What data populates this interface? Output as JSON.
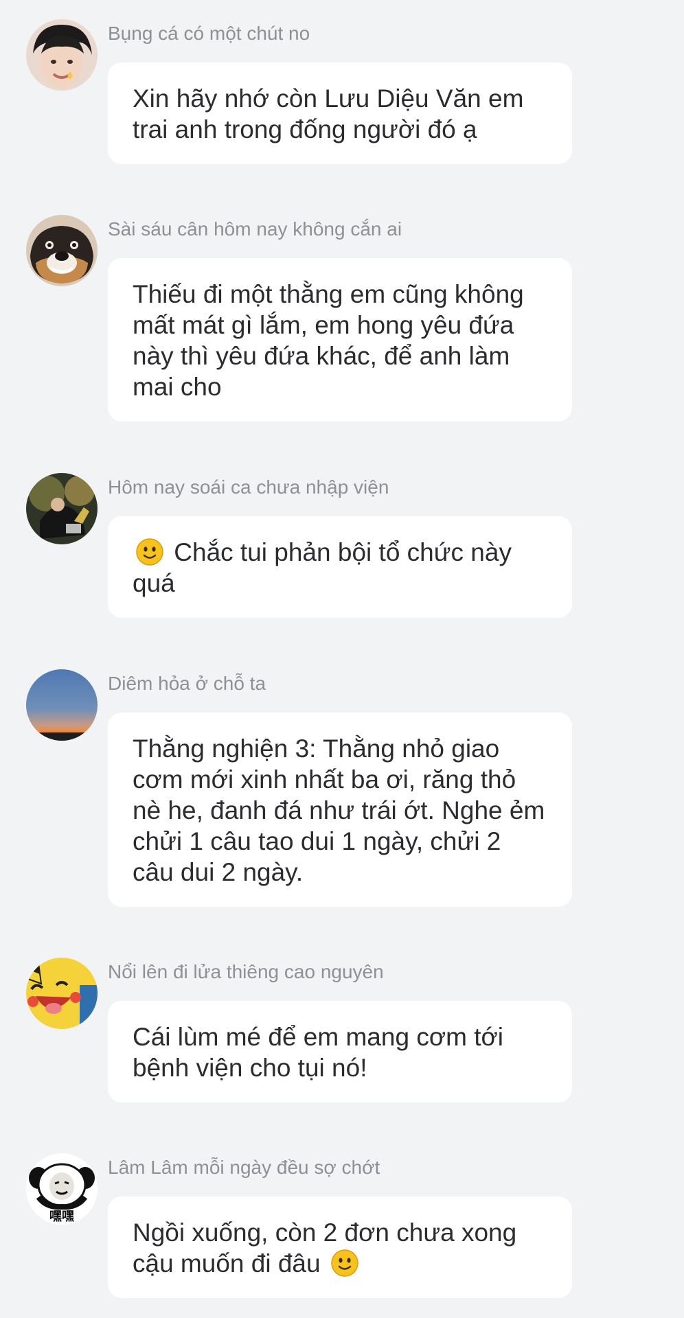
{
  "messages": [
    {
      "sender": "Bụng cá có một chút no",
      "text": "Xin hãy nhớ còn Lưu Diệu Văn em trai anh trong đống người đó ạ",
      "avatar_icon": "boy-photo-avatar"
    },
    {
      "sender": "Sài sáu cân hôm nay không cắn ai",
      "text": "Thiếu đi một thằng em cũng không mất mát gì lắm, em hong yêu đứa này thì yêu đứa khác, để anh làm mai cho",
      "avatar_icon": "shiba-dog-avatar"
    },
    {
      "sender": "Hôm nay soái ca chưa nhập viện",
      "text_before": "",
      "text_after": " Chắc tui phản bội tổ chức này quá",
      "emoji": "slight-smile-emoji",
      "avatar_icon": "dark-photo-avatar"
    },
    {
      "sender": "Diêm hỏa ở chỗ ta",
      "text": "Thằng nghiện 3: Thằng nhỏ giao cơm mới xinh nhất ba ơi, răng thỏ nè he, đanh đá như trái ớt. Nghe ẻm chửi 1 câu tao dui 1 ngày, chửi 2 câu dui 2 ngày.",
      "avatar_icon": "sunset-sky-avatar"
    },
    {
      "sender": "Nổi lên đi lửa thiêng cao nguyên",
      "text": "Cái lùm mé để em mang cơm tới bệnh viện cho tụi nó!",
      "avatar_icon": "pikachu-avatar"
    },
    {
      "sender": "Lâm Lâm mỗi ngày đều sợ chớt",
      "text_before": "Ngồi xuống, còn 2 đơn chưa xong cậu muốn đi đâu ",
      "text_after": "",
      "emoji": "slight-smile-emoji",
      "avatar_icon": "panda-meme-avatar",
      "avatar_caption": "嘿嘿"
    }
  ],
  "colors": {
    "background": "#f2f3f5",
    "bubble": "#ffffff",
    "sender_name": "#8e9096",
    "message_text": "#2b2c30",
    "emoji": "#f7c21b"
  }
}
